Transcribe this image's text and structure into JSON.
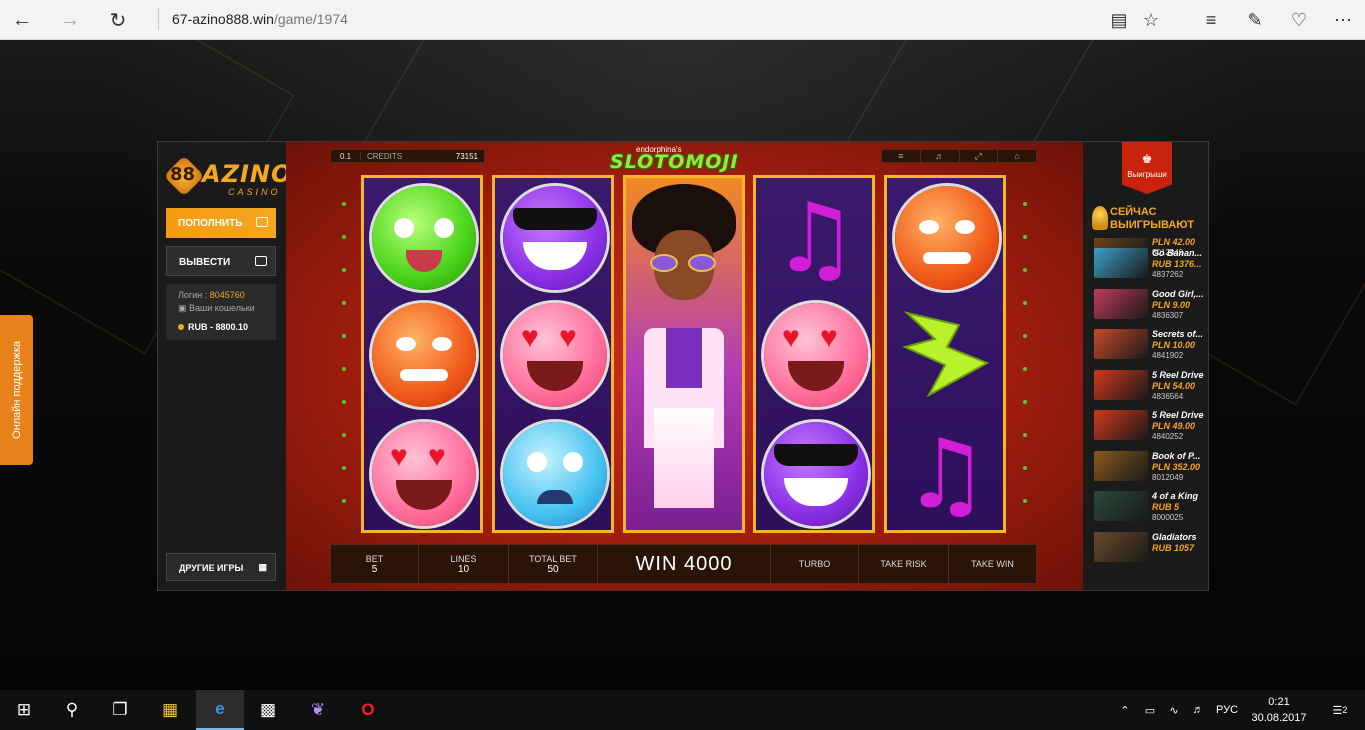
{
  "browser": {
    "url_domain": "67-azino888.win",
    "url_path": "/game/1974"
  },
  "support": {
    "label": "Онлайн поддержка"
  },
  "sidebar": {
    "logo_text": "AZINO",
    "logo_sub": "CASINO",
    "logo_badge": "88",
    "deposit_label": "ПОПОЛНИТЬ",
    "withdraw_label": "ВЫВЕСТИ",
    "login_label": "Логин :",
    "login_value": "8045760",
    "wallets_label": "Ваши кошельки",
    "balance": "RUB - 8800.10",
    "other_games_label": "ДРУГИЕ ИГРЫ"
  },
  "game": {
    "bet_small": "0.1",
    "credits_label": "CREDITS",
    "credits_value": "73151",
    "brand": "endorphina's",
    "title": "SLOTOMOJI",
    "bet_label": "BET",
    "bet_value": "5",
    "lines_label": "LINES",
    "lines_value": "10",
    "total_bet_label": "TOTAL BET",
    "total_bet_value": "50",
    "win_text": "WIN 4000",
    "turbo_label": "TURBO",
    "take_risk_label": "TAKE RISK",
    "take_win_label": "TAKE WIN"
  },
  "winners": {
    "tab_label": "Выигрыши",
    "heading_line1": "СЕЙЧАС",
    "heading_line2": "ВЫИГРЫВАЮТ",
    "items": [
      {
        "name": "",
        "amount": "PLN 42.00",
        "id": "8012049",
        "color": "#7a4a1a"
      },
      {
        "name": "Go Banan...",
        "amount": "RUB 1376...",
        "id": "4837262",
        "color": "#3aa0c9"
      },
      {
        "name": "Good Girl,...",
        "amount": "PLN 9.00",
        "id": "4836307",
        "color": "#c23a5a"
      },
      {
        "name": "Secrets of...",
        "amount": "PLN 10.00",
        "id": "4841902",
        "color": "#c94a2a"
      },
      {
        "name": "5 Reel Drive",
        "amount": "PLN 54.00",
        "id": "4836564",
        "color": "#d2381a"
      },
      {
        "name": "5 Reel Drive",
        "amount": "PLN 49.00",
        "id": "4840252",
        "color": "#d2381a"
      },
      {
        "name": "Book of P...",
        "amount": "PLN 352.00",
        "id": "8012049",
        "color": "#8a5a1a"
      },
      {
        "name": "4 of a King",
        "amount": "RUB 5",
        "id": "8000025",
        "color": "#2a4a3a"
      },
      {
        "name": "Gladiators",
        "amount": "RUB 1057",
        "id": "",
        "color": "#6a4a2a"
      }
    ]
  },
  "taskbar": {
    "language": "РУС",
    "time": "0:21",
    "date": "30.08.2017",
    "notifications": "2"
  }
}
